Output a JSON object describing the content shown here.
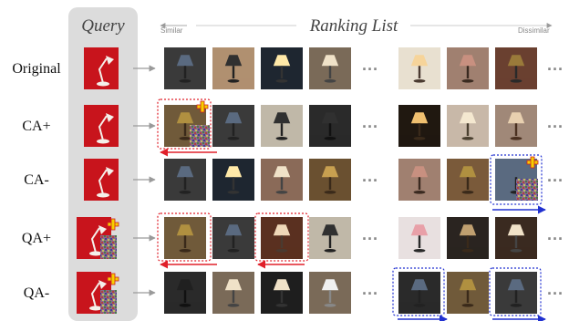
{
  "header": {
    "query_label": "Query",
    "ranking_label": "Ranking List",
    "similar_label": "Similar",
    "dissimilar_label": "Dissimilar"
  },
  "rows": [
    {
      "label": "Original",
      "query_perturbed": false
    },
    {
      "label": "CA+",
      "query_perturbed": false
    },
    {
      "label": "CA-",
      "query_perturbed": false
    },
    {
      "label": "QA+",
      "query_perturbed": true
    },
    {
      "label": "QA-",
      "query_perturbed": true
    }
  ],
  "ellipsis": "···",
  "colors": {
    "query_panel": "#dcdcdc",
    "red_marker": "#e0202a",
    "blue_marker": "#2030d0",
    "arrow_gray": "#9a9a9a",
    "perturb_cross": "#f5d000"
  },
  "icons": [
    "lamp-thumbnail-icon",
    "perturbation-cross-icon",
    "arrow-right-icon",
    "rank-shift-arrow-icon"
  ]
}
